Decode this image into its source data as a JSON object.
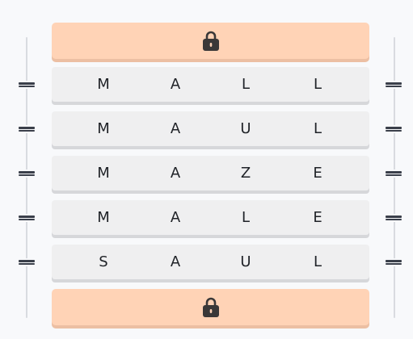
{
  "locked_rows": {
    "top": {
      "icon": "lock-icon",
      "locked": true
    },
    "bottom": {
      "icon": "lock-icon",
      "locked": true
    }
  },
  "rows": [
    {
      "letters": [
        "M",
        "A",
        "L",
        "L"
      ]
    },
    {
      "letters": [
        "M",
        "A",
        "U",
        "L"
      ]
    },
    {
      "letters": [
        "M",
        "A",
        "Z",
        "E"
      ]
    },
    {
      "letters": [
        "M",
        "A",
        "L",
        "E"
      ]
    },
    {
      "letters": [
        "S",
        "A",
        "U",
        "L"
      ]
    }
  ],
  "drag_handles": {
    "icon": "drag-handle-icon"
  },
  "colors": {
    "locked_row": "#ffd3b6",
    "word_row": "#efeff0",
    "letter": "#1f2227",
    "handle": "#3a3f4a"
  }
}
